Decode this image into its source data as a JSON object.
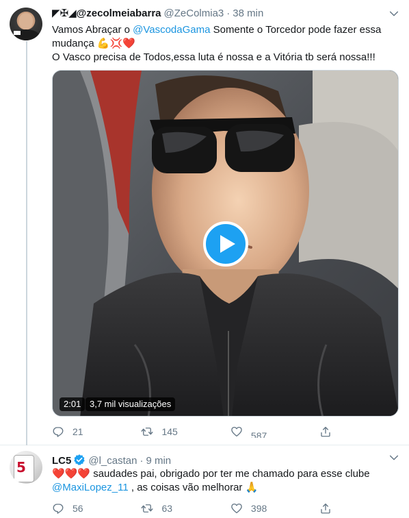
{
  "tweet1": {
    "author_badges": "◤✠◢",
    "author_name": "@zecolmeiabarra",
    "handle": "@ZeColmia3",
    "separator": "·",
    "time": "38 min",
    "text_part1": "Vamos Abraçar o ",
    "mention": "@VascodaGama",
    "text_part2": "  Somente o Torcedor pode fazer essa mudança ",
    "emojis": "💪💢❤️",
    "text_line3": "O Vasco precisa de Todos,essa luta é nossa e a Vitória tb será nossa!!!",
    "video": {
      "duration": "2:01",
      "views": "3,7 mil visualizações"
    },
    "counts": {
      "replies": "21",
      "retweets": "145",
      "likes": "587"
    }
  },
  "tweet2": {
    "author_name": "LC5",
    "handle": "@l_castan",
    "separator": "·",
    "time": "9 min",
    "hearts": "❤️❤️❤️",
    "text_part1": " saudades pai, obrigado por ter me chamado para esse clube",
    "mention": "@MaxiLopez_11",
    "text_part2": " , as coisas vão melhorar ",
    "emoji_end": "🙏",
    "avatar_number": "5",
    "counts": {
      "replies": "56",
      "retweets": "63",
      "likes": "398"
    }
  },
  "colors": {
    "accent": "#1da1f2",
    "link": "#1b95e0",
    "secondary_text": "#657786",
    "primary_text": "#14171a",
    "verified": "#1da1f2",
    "heart": "#e0245e"
  }
}
